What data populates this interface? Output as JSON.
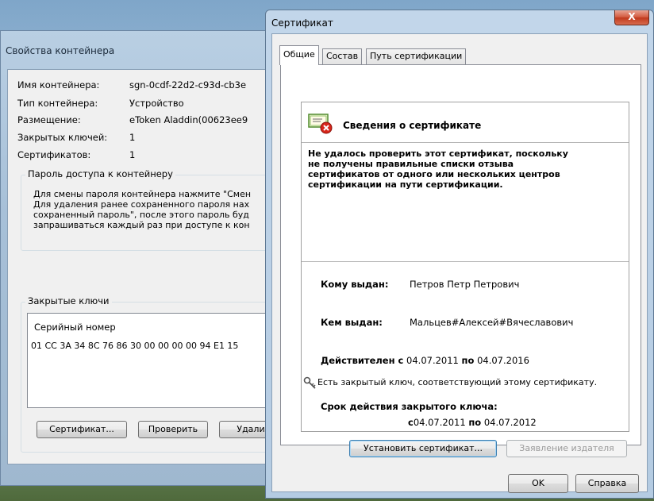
{
  "container_window": {
    "title": "Свойства контейнера",
    "properties": [
      {
        "label": "Имя контейнера:",
        "value": "sgn-0cdf-22d2-c93d-cb3e"
      },
      {
        "label": "Тип контейнера:",
        "value": "Устройство"
      },
      {
        "label": "Размещение:",
        "value": "eToken Aladdin(00623ee9"
      },
      {
        "label": "Закрытых ключей:",
        "value": "1"
      },
      {
        "label": "Сертификатов:",
        "value": "1"
      }
    ],
    "password_group": {
      "title": "Пароль доступа к контейнеру",
      "lines": [
        "Для смены пароля контейнера нажмите \"Смен",
        "Для удаления ранее сохраненного пароля нах",
        "сохраненный пароль\", после этого пароль буд",
        "запрашиваться каждый раз при доступе к кон"
      ]
    },
    "keys_group": {
      "title": "Закрытые ключи",
      "column_header": "Серийный номер",
      "rows": [
        "01 CC 3A 34 8C 76 86 30 00 00 00 00 94 E1 15"
      ]
    },
    "buttons": {
      "certificate": "Сертификат...",
      "check": "Проверить",
      "delete": "Удали"
    }
  },
  "cert_dialog": {
    "title": "Сертификат",
    "close_label": "X",
    "tabs": [
      "Общие",
      "Состав",
      "Путь сертификации"
    ],
    "info_heading": "Сведения о сертификате",
    "warning_lines": [
      "Не удалось проверить этот сертификат, поскольку",
      "не получены правильные списки отзыва",
      "сертификатов от одного или нескольких центров",
      "сертификации на пути сертификации."
    ],
    "issued_to_label": "Кому выдан:",
    "issued_to": "Петров Петр Петрович",
    "issued_by_label": "Кем выдан:",
    "issued_by": "Мальцев#Алексей#Вячеславович",
    "valid_label_from": "Действителен с",
    "valid_from": "04.07.2011",
    "valid_label_to": "по",
    "valid_to": "04.07.2016",
    "private_key_note": "Есть закрытый ключ, соответствующий этому сертификату.",
    "key_validity_heading": "Срок действия закрытого ключа:",
    "key_from_label": "с",
    "key_from": "04.07.2011",
    "key_to_label": "по",
    "key_to": "04.07.2012",
    "buttons": {
      "install": "Установить сертификат...",
      "issuer_statement": "Заявление издателя",
      "ok": "OK",
      "help": "Справка"
    }
  }
}
